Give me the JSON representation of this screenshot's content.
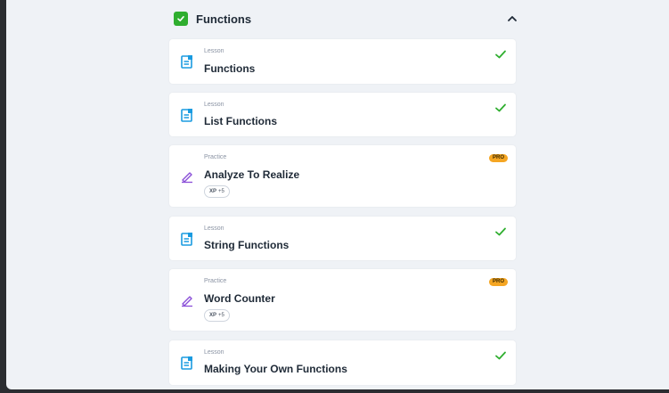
{
  "module": {
    "title": "Functions",
    "completed": true,
    "expanded": true
  },
  "items": [
    {
      "type": "Lesson",
      "title": "Functions",
      "kind": "lesson",
      "status": "done"
    },
    {
      "type": "Lesson",
      "title": "List Functions",
      "kind": "lesson",
      "status": "done"
    },
    {
      "type": "Practice",
      "title": "Analyze To Realize",
      "kind": "practice",
      "badge": "PRO",
      "xp_label": "XP",
      "xp_value": "+5"
    },
    {
      "type": "Lesson",
      "title": "String Functions",
      "kind": "lesson",
      "status": "done"
    },
    {
      "type": "Practice",
      "title": "Word Counter",
      "kind": "practice",
      "badge": "PRO",
      "xp_label": "XP",
      "xp_value": "+5"
    },
    {
      "type": "Lesson",
      "title": "Making Your Own Functions",
      "kind": "lesson",
      "status": "done"
    }
  ],
  "colors": {
    "check_green": "#2fae2f",
    "lesson_icon": "#1a9be0",
    "practice_icon": "#8a4fd8",
    "pro_badge": "#f5a623"
  },
  "icons": {
    "lesson": "document-icon",
    "practice": "pencil-icon",
    "done": "checkmark-icon",
    "collapse": "chevron-up-icon"
  }
}
